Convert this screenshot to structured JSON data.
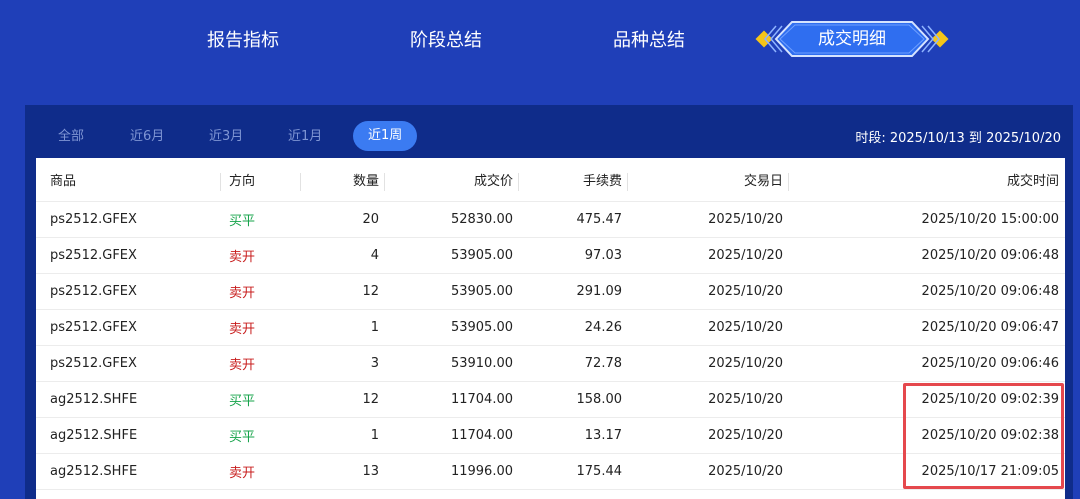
{
  "nav": {
    "items": [
      {
        "label": "报告指标"
      },
      {
        "label": "阶段总结"
      },
      {
        "label": "品种总结"
      }
    ],
    "active": {
      "label": "成交明细"
    }
  },
  "filters": {
    "items": [
      "全部",
      "近6月",
      "近3月",
      "近1月"
    ],
    "active": "近1周"
  },
  "period": "时段: 2025/10/13 到 2025/10/20",
  "table": {
    "headers": [
      "商品",
      "方向",
      "数量",
      "成交价",
      "手续费",
      "交易日",
      "成交时间"
    ],
    "rows": [
      [
        "ps2512.GFEX",
        "买平",
        "20",
        "52830.00",
        "475.47",
        "2025/10/20",
        "2025/10/20 15:00:00"
      ],
      [
        "ps2512.GFEX",
        "卖开",
        "4",
        "53905.00",
        "97.03",
        "2025/10/20",
        "2025/10/20 09:06:48"
      ],
      [
        "ps2512.GFEX",
        "卖开",
        "12",
        "53905.00",
        "291.09",
        "2025/10/20",
        "2025/10/20 09:06:48"
      ],
      [
        "ps2512.GFEX",
        "卖开",
        "1",
        "53905.00",
        "24.26",
        "2025/10/20",
        "2025/10/20 09:06:47"
      ],
      [
        "ps2512.GFEX",
        "卖开",
        "3",
        "53910.00",
        "72.78",
        "2025/10/20",
        "2025/10/20 09:06:46"
      ],
      [
        "ag2512.SHFE",
        "买平",
        "12",
        "11704.00",
        "158.00",
        "2025/10/20",
        "2025/10/20 09:02:39"
      ],
      [
        "ag2512.SHFE",
        "买平",
        "1",
        "11704.00",
        "13.17",
        "2025/10/20",
        "2025/10/20 09:02:38"
      ],
      [
        "ag2512.SHFE",
        "卖开",
        "13",
        "11996.00",
        "175.44",
        "2025/10/20",
        "2025/10/17 21:09:05"
      ]
    ]
  },
  "colors": {
    "background": "#1f3fb8",
    "panel": "#0f2c8a",
    "accent": "#3b7bf2",
    "buy": "#16a34a",
    "sell": "#c81e1e",
    "highlight": "#e5484d"
  }
}
